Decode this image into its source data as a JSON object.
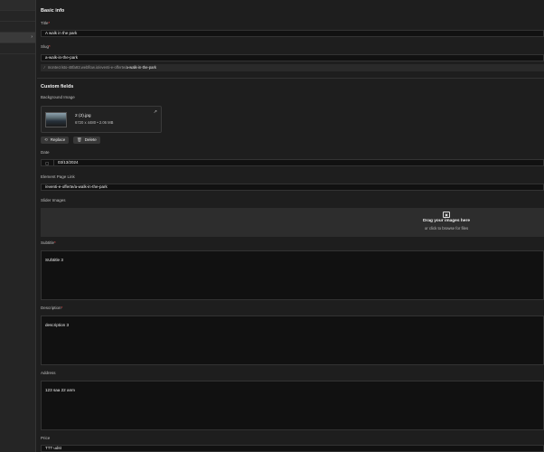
{
  "basic_info": {
    "heading": "Basic info",
    "title_label": "Title",
    "title_value": "A walk in the park",
    "slug_label": "Slug",
    "slug_value": "a-walk-in-the-park",
    "url_prefix": "montecristo-48fa93.webflow.io/eventi-e-offerte/",
    "url_slug": "a-walk-in-the-park"
  },
  "custom_fields": {
    "heading": "Custom fields",
    "background_image_label": "Background Image",
    "file_name": "2 (2).jpg",
    "file_meta": "6720 x 4480 • 2.06 MB",
    "replace_label": "Replace",
    "delete_label": "Delete",
    "date_label": "Date",
    "date_value": "03/13/2024",
    "element_link_label": "Element Page Link",
    "element_link_value": "/eventi-e-offerte/a-walk-in-the-park",
    "slider_label": "Slider Images",
    "dropzone_title": "Drag your images here",
    "dropzone_sub": "or click to browse for files",
    "subtitle_label": "Subtitle",
    "subtitle_value": "SUbtitle 3",
    "description_label": "Description",
    "description_value": "description 3",
    "address_label": "Address",
    "address_value": "123 saa 22 anm",
    "price_label": "Price",
    "price_value": "TTT udst"
  },
  "required_marker": "*",
  "icons": {
    "chevron": "›",
    "lock": "⁄",
    "external": "↗",
    "replace": "⟲",
    "delete": "🗑",
    "calendar": "▢",
    "image": "▣"
  },
  "colors": {
    "background": "#1e1e1e",
    "input_bg": "#111111",
    "required": "#ff4a4a"
  }
}
